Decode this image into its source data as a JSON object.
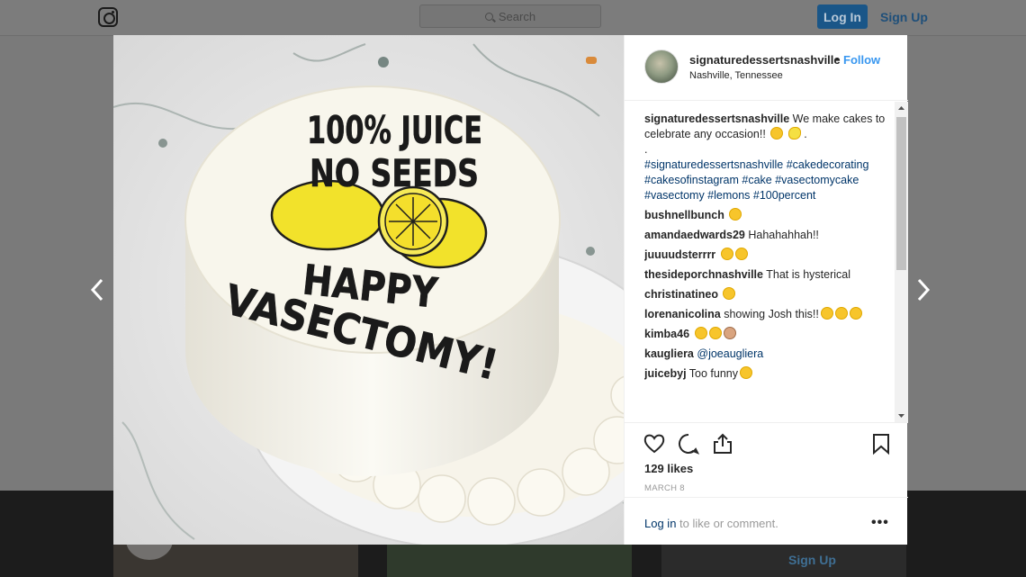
{
  "nav": {
    "search_placeholder": "Search",
    "login_label": "Log In",
    "signup_label": "Sign Up"
  },
  "post": {
    "username": "signaturedessertsnashville",
    "separator": "•",
    "follow_label": "Follow",
    "location": "Nashville, Tennessee",
    "caption_text": "We make cakes to celebrate any occasion!!",
    "caption_dot": ".",
    "hashtags": "#signaturedessertsnashville #cakedecorating #cakesofinstagram #cake #vasectomycake #vasectomy #lemons #100percent",
    "cake_text_1": "100% JUICE",
    "cake_text_2": "NO SEEDS",
    "cake_text_3": "HAPPY",
    "cake_text_4": "VASECTOMY!",
    "likes": "129 likes",
    "date": "MARCH 8",
    "login_link": "Log in",
    "login_suffix": " to like or comment.",
    "more": "•••"
  },
  "comments": [
    {
      "user": "bushnellbunch",
      "text": "",
      "emoji": [
        "laugh"
      ]
    },
    {
      "user": "amandaedwards29",
      "text": "Hahahahhah!!",
      "emoji": []
    },
    {
      "user": "juuuudsterrrr",
      "text": "",
      "emoji": [
        "laugh",
        "laugh"
      ]
    },
    {
      "user": "thesideporchnashville",
      "text": "That is hysterical",
      "emoji": []
    },
    {
      "user": "christinatineo",
      "text": "",
      "emoji": [
        "laugh"
      ]
    },
    {
      "user": "lorenanicolina",
      "text": "showing Josh this!!",
      "emoji": [
        "laugh",
        "laugh",
        "laugh-end"
      ]
    },
    {
      "user": "kimba46",
      "text": "",
      "emoji": [
        "laugh",
        "laugh",
        "person"
      ]
    },
    {
      "user": "kaugliera",
      "text": "@joeaugliera",
      "emoji": []
    },
    {
      "user": "juicebyj",
      "text": "Too funny",
      "emoji": [
        "laugh"
      ]
    }
  ],
  "bottom": {
    "signup_label": "Sign Up"
  },
  "colors": {
    "link_blue": "#3897f0",
    "hashtag_blue": "#003569",
    "text": "#262626"
  }
}
